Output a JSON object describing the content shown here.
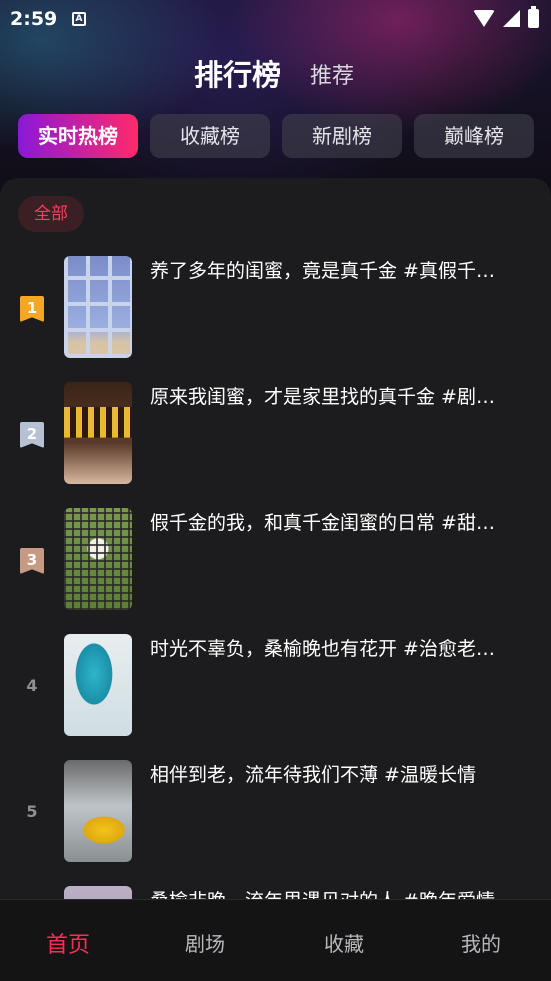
{
  "status_bar": {
    "time": "2:59",
    "a_badge": "A"
  },
  "header": {
    "title": "排行榜",
    "subtitle": "推荐"
  },
  "tabs": [
    {
      "label": "实时热榜",
      "active": true
    },
    {
      "label": "收藏榜",
      "active": false
    },
    {
      "label": "新剧榜",
      "active": false
    },
    {
      "label": "巅峰榜",
      "active": false
    }
  ],
  "filter_chip": "全部",
  "items": [
    {
      "rank": "1",
      "title": "养了多年的闺蜜，竟是真千金 #真假千…"
    },
    {
      "rank": "2",
      "title": "原来我闺蜜，才是家里找的真千金 #剧…"
    },
    {
      "rank": "3",
      "title": "假千金的我，和真千金闺蜜的日常 #甜…"
    },
    {
      "rank": "4",
      "title": "时光不辜负，桑榆晚也有花开 #治愈老…"
    },
    {
      "rank": "5",
      "title": "相伴到老，流年待我们不薄 #温暖长情"
    },
    {
      "rank": "",
      "title": "桑榆非晚，流年里遇见对的人 #晚年爱情"
    }
  ],
  "bottom_nav": [
    {
      "label": "首页",
      "active": true
    },
    {
      "label": "剧场",
      "active": false
    },
    {
      "label": "收藏",
      "active": false
    },
    {
      "label": "我的",
      "active": false
    }
  ],
  "colors": {
    "accent": "#ff2d55",
    "tab_gradient_start": "#8a18d8",
    "tab_gradient_end": "#ff2a6a",
    "gold": "#f5a623",
    "silver": "#b6c2d4",
    "bronze": "#c79a83"
  }
}
